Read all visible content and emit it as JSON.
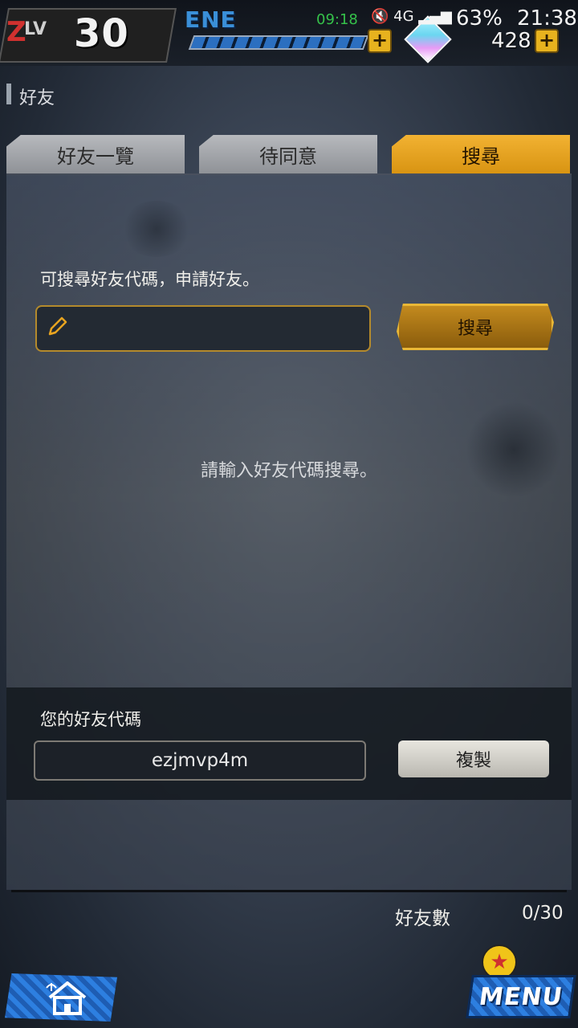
{
  "status_bar": {
    "network": "4G",
    "battery": "63%",
    "time": "21:38"
  },
  "game_bar": {
    "level_prefix": "Z",
    "level_label": "LV",
    "level_value": "30",
    "energy_label": "ENE",
    "energy_clock": "09:18",
    "crystal_count": "428",
    "plus_symbol": "+"
  },
  "page": {
    "title": "好友"
  },
  "tabs": [
    {
      "label": "好友一覽",
      "active": false
    },
    {
      "label": "待同意",
      "active": false
    },
    {
      "label": "搜尋",
      "active": true
    }
  ],
  "search": {
    "hint": "可搜尋好友代碼，申請好友。",
    "input_value": "",
    "button_label": "搜尋",
    "empty_message": "請輸入好友代碼搜尋。"
  },
  "my_code": {
    "label": "您的好友代碼",
    "value": "ezjmvp4m",
    "copy_label": "複製"
  },
  "footer": {
    "friend_count_label": "好友數",
    "friend_count_value": "0/30",
    "menu_label": "MENU"
  },
  "colors": {
    "accent": "#e7a320",
    "panel": "#4a5465",
    "menu_blue": "#2d7fe0"
  },
  "icons": {
    "pencil": "pencil-icon",
    "home": "home-icon",
    "crystal": "crystal-icon",
    "star": "star-icon"
  }
}
